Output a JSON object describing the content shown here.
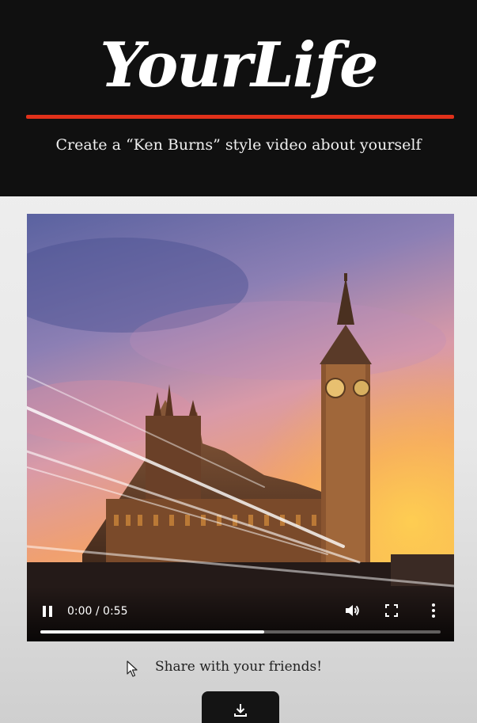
{
  "header": {
    "logo_text": "YourLife",
    "tagline": "Create a “Ken Burns” style video about yourself"
  },
  "video": {
    "time_display": "0:00 / 0:55",
    "progress_fraction": 0.56,
    "state": "playing"
  },
  "share": {
    "label": "Share with your friends!"
  },
  "icons": {
    "play_state": "pause-icon",
    "volume": "volume-icon",
    "fullscreen": "fullscreen-icon",
    "more": "more-vertical-icon",
    "download": "download-icon"
  },
  "colors": {
    "header_bg": "#101010",
    "accent_rule": "#e1311a"
  }
}
